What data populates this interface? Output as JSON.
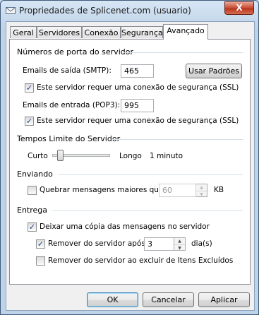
{
  "window": {
    "title": "Propriedades de Splicenet.com (usuario)",
    "close_glyph": "X"
  },
  "tabs": [
    {
      "label": "Geral",
      "active": false
    },
    {
      "label": "Servidores",
      "active": false
    },
    {
      "label": "Conexão",
      "active": false
    },
    {
      "label": "Segurança",
      "active": false
    },
    {
      "label": "Avançado",
      "active": true
    }
  ],
  "ports": {
    "group_title": "Números de porta do servidor",
    "smtp_label": "Emails de saída (SMTP):",
    "smtp_value": "465",
    "defaults_button": "Usar Padrões",
    "smtp_ssl_label": "Este servidor requer uma conexão de segurança (SSL)",
    "smtp_ssl_checked": true,
    "pop3_label": "Emails de entrada (POP3):",
    "pop3_value": "995",
    "pop3_ssl_label": "Este servidor requer uma conexão de segurança (SSL)",
    "pop3_ssl_checked": true
  },
  "timeouts": {
    "group_title": "Tempos Limite do Servidor",
    "short_label": "Curto",
    "long_label": "Longo",
    "value_label": "1 minuto",
    "slider_fraction": 0.1
  },
  "sending": {
    "group_title": "Enviando",
    "split_label": "Quebrar mensagens maiores que",
    "split_checked": false,
    "split_value": "60",
    "unit": "KB"
  },
  "delivery": {
    "group_title": "Entrega",
    "leave_copy_label": "Deixar uma cópia das mensagens no servidor",
    "leave_copy_checked": true,
    "remove_after_label": "Remover do servidor após",
    "remove_after_checked": true,
    "remove_after_value": "3",
    "days_unit": "dia(s)",
    "remove_deleted_label": "Remover do servidor ao excluir de Itens Excluídos",
    "remove_deleted_checked": false
  },
  "footer": {
    "ok": "OK",
    "cancel": "Cancelar",
    "apply": "Aplicar"
  },
  "icons": {
    "check_glyph": "✓",
    "spin_up": "▲",
    "spin_down": "▼"
  }
}
